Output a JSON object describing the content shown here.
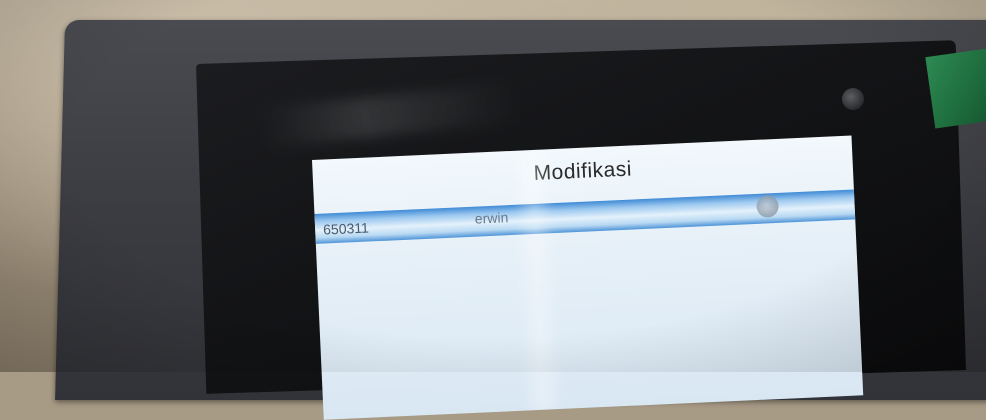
{
  "screen": {
    "title": "Modifikasi",
    "rows": [
      {
        "id": "650311",
        "name": "erwin"
      }
    ]
  },
  "colors": {
    "selection": "#3f8ad6",
    "screen_bg": "#e6f0f8",
    "bezel": "#3b3c41",
    "tape": "#1e6f3e"
  },
  "icons": {
    "row_icon": "settings-icon"
  }
}
